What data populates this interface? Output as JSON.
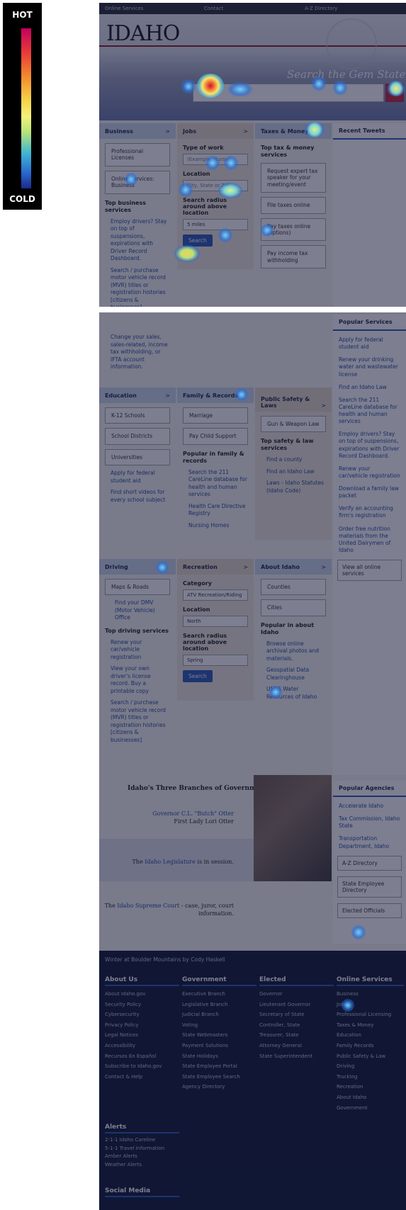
{
  "legend": {
    "hot": "HOT",
    "cold": "COLD"
  },
  "topbar": {
    "online_services": "Online Services",
    "contact": "Contact",
    "az": "A-Z Directory"
  },
  "header": {
    "logo": "IDAHO",
    "tagline": "Search the Gem State"
  },
  "business": {
    "title": "Business",
    "boxes": [
      "Professional Licenses",
      "Online Services: Business"
    ],
    "top_title": "Top business services",
    "links": [
      "Employ drivers? Stay on top of suspensions, expirations with Driver Record Dashboard.",
      "Search / purchase motor vehicle record (MVR) titles or registration histories [citizens & businesses]",
      "Change your sales, sales-related, income tax withholding, or IFTA account information."
    ]
  },
  "jobs": {
    "title": "Jobs",
    "type_label": "Type of work",
    "type_placeholder": "(Example: Nurse)",
    "location_label": "Location",
    "location_placeholder": "City, State or ZIP",
    "radius_label": "Search radius around above location",
    "radius_value": "5 miles",
    "search": "Search"
  },
  "taxes": {
    "title": "Taxes & Money",
    "top_title": "Top tax & money services",
    "boxes": [
      "Request expert tax speaker for your meeting/event",
      "File taxes online",
      "Pay taxes online (options)",
      "Pay income tax withholding"
    ]
  },
  "tweets": {
    "title": "Recent Tweets"
  },
  "popular_services": {
    "title": "Popular Services",
    "links": [
      "Apply for federal student aid",
      "Renew your drinking water and wastewater license",
      "Find an Idaho Law",
      "Search the 211 CareLine database for health and human services",
      "Employ drivers? Stay on top of suspensions, expirations with Driver Record Dashboard.",
      "Renew your car/vehicle registration",
      "Download a family law packet",
      "Verify an accounting firm's registration",
      "Order free nutrition materials from the United Dairymen of Idaho"
    ],
    "view_all": "View all online services"
  },
  "education": {
    "title": "Education",
    "boxes": [
      "K-12 Schools",
      "School Districts",
      "Universities"
    ],
    "links": [
      "Apply for federal student aid",
      "Find short videos for every school subject"
    ]
  },
  "family": {
    "title": "Family & Records",
    "boxes": [
      "Marriage",
      "Pay Child Support"
    ],
    "top_title": "Popular in family & records",
    "links": [
      "Search the 211 CareLine database for health and human services",
      "Health Care Directive Registry",
      "Nursing Homes"
    ]
  },
  "safety": {
    "title": "Public Safety & Laws",
    "boxes": [
      "Gun & Weapon Law"
    ],
    "top_title": "Top safety & law services",
    "links": [
      "Find a county",
      "Find an Idaho Law",
      "Laws - Idaho Statutes (Idaho Code)"
    ]
  },
  "driving": {
    "title": "Driving",
    "boxes": [
      "Maps & Roads"
    ],
    "dmv": "Find your DMV (Motor Vehicle) Office",
    "top_title": "Top driving services",
    "links": [
      "Renew your car/vehicle registration",
      "View your own driver's license record. Buy a printable copy",
      "Search / purchase motor vehicle record (MVR) titles or registration histories [citizens & businesses]"
    ]
  },
  "recreation": {
    "title": "Recreation",
    "category_label": "Category",
    "category_value": "ATV Recreation/Riding",
    "location_label": "Location",
    "location_value": "North",
    "radius_label": "Search radius around above location",
    "radius_value": "Spring",
    "search": "Search"
  },
  "about": {
    "title": "About Idaho",
    "boxes": [
      "Counties",
      "Cities"
    ],
    "top_title": "Popular in about Idaho",
    "links": [
      "Browse online archival photos and materials.",
      "Geospatial Data Clearinghouse",
      "USGS Water Resources of Idaho"
    ]
  },
  "popular_agencies": {
    "title": "Popular Agencies",
    "links": [
      "Accelerate Idaho",
      "Tax Commission, Idaho State",
      "Transportation Department, Idaho"
    ],
    "boxes": [
      "A-Z Directory",
      "State Employee Directory",
      "Elected Officials"
    ]
  },
  "branches": {
    "title": "Idaho's Three Branches of Government",
    "governor_link": "Governor C.L. \"Butch\" Otter",
    "first_lady": "First Lady Lori Otter",
    "legislature_pre": "The ",
    "legislature_link": "Idaho Legislature",
    "legislature_post": " is in session.",
    "court_pre": "The ",
    "court_link": "Idaho Supreme Court",
    "court_post": " - case, juror, court information."
  },
  "footer": {
    "photo_credit": "Winter at Boulder Mountains by Cody Haskell",
    "columns": [
      {
        "title": "About Us",
        "items": [
          "About Idaho.gov",
          "Security Policy",
          "Cybersecurity",
          "Privacy Policy",
          "Legal Notices",
          "Accessibility",
          "Recursos En Español",
          "Subscribe to Idaho.gov",
          "Contact & Help"
        ]
      },
      {
        "title": "Government",
        "items": [
          "Executive Branch",
          "Legislative Branch",
          "Judicial Branch",
          "Voting",
          "State Webmasters",
          "Payment Solutions",
          "State Holidays",
          "State Employee Portal",
          "State Employee Search",
          "Agency Directory"
        ]
      },
      {
        "title": "Elected",
        "items": [
          "Governor",
          "Lieutenant Governor",
          "Secretary of State",
          "Controller, State",
          "Treasurer, State",
          "Attorney General",
          "State Superintendent"
        ]
      },
      {
        "title": "Online Services",
        "items": [
          "Business",
          "Jobs",
          "Professional Licensing",
          "Taxes & Money",
          "Education",
          "Family Records",
          "Public Safety & Law",
          "Driving",
          "Trucking",
          "Recreation",
          "About Idaho",
          "Government"
        ]
      }
    ],
    "alerts_title": "Alerts",
    "alerts": [
      "2-1-1 Idaho Careline",
      "5-1-1 Travel Information",
      "Amber Alerts",
      "Weather Alerts"
    ],
    "social_title": "Social Media"
  }
}
